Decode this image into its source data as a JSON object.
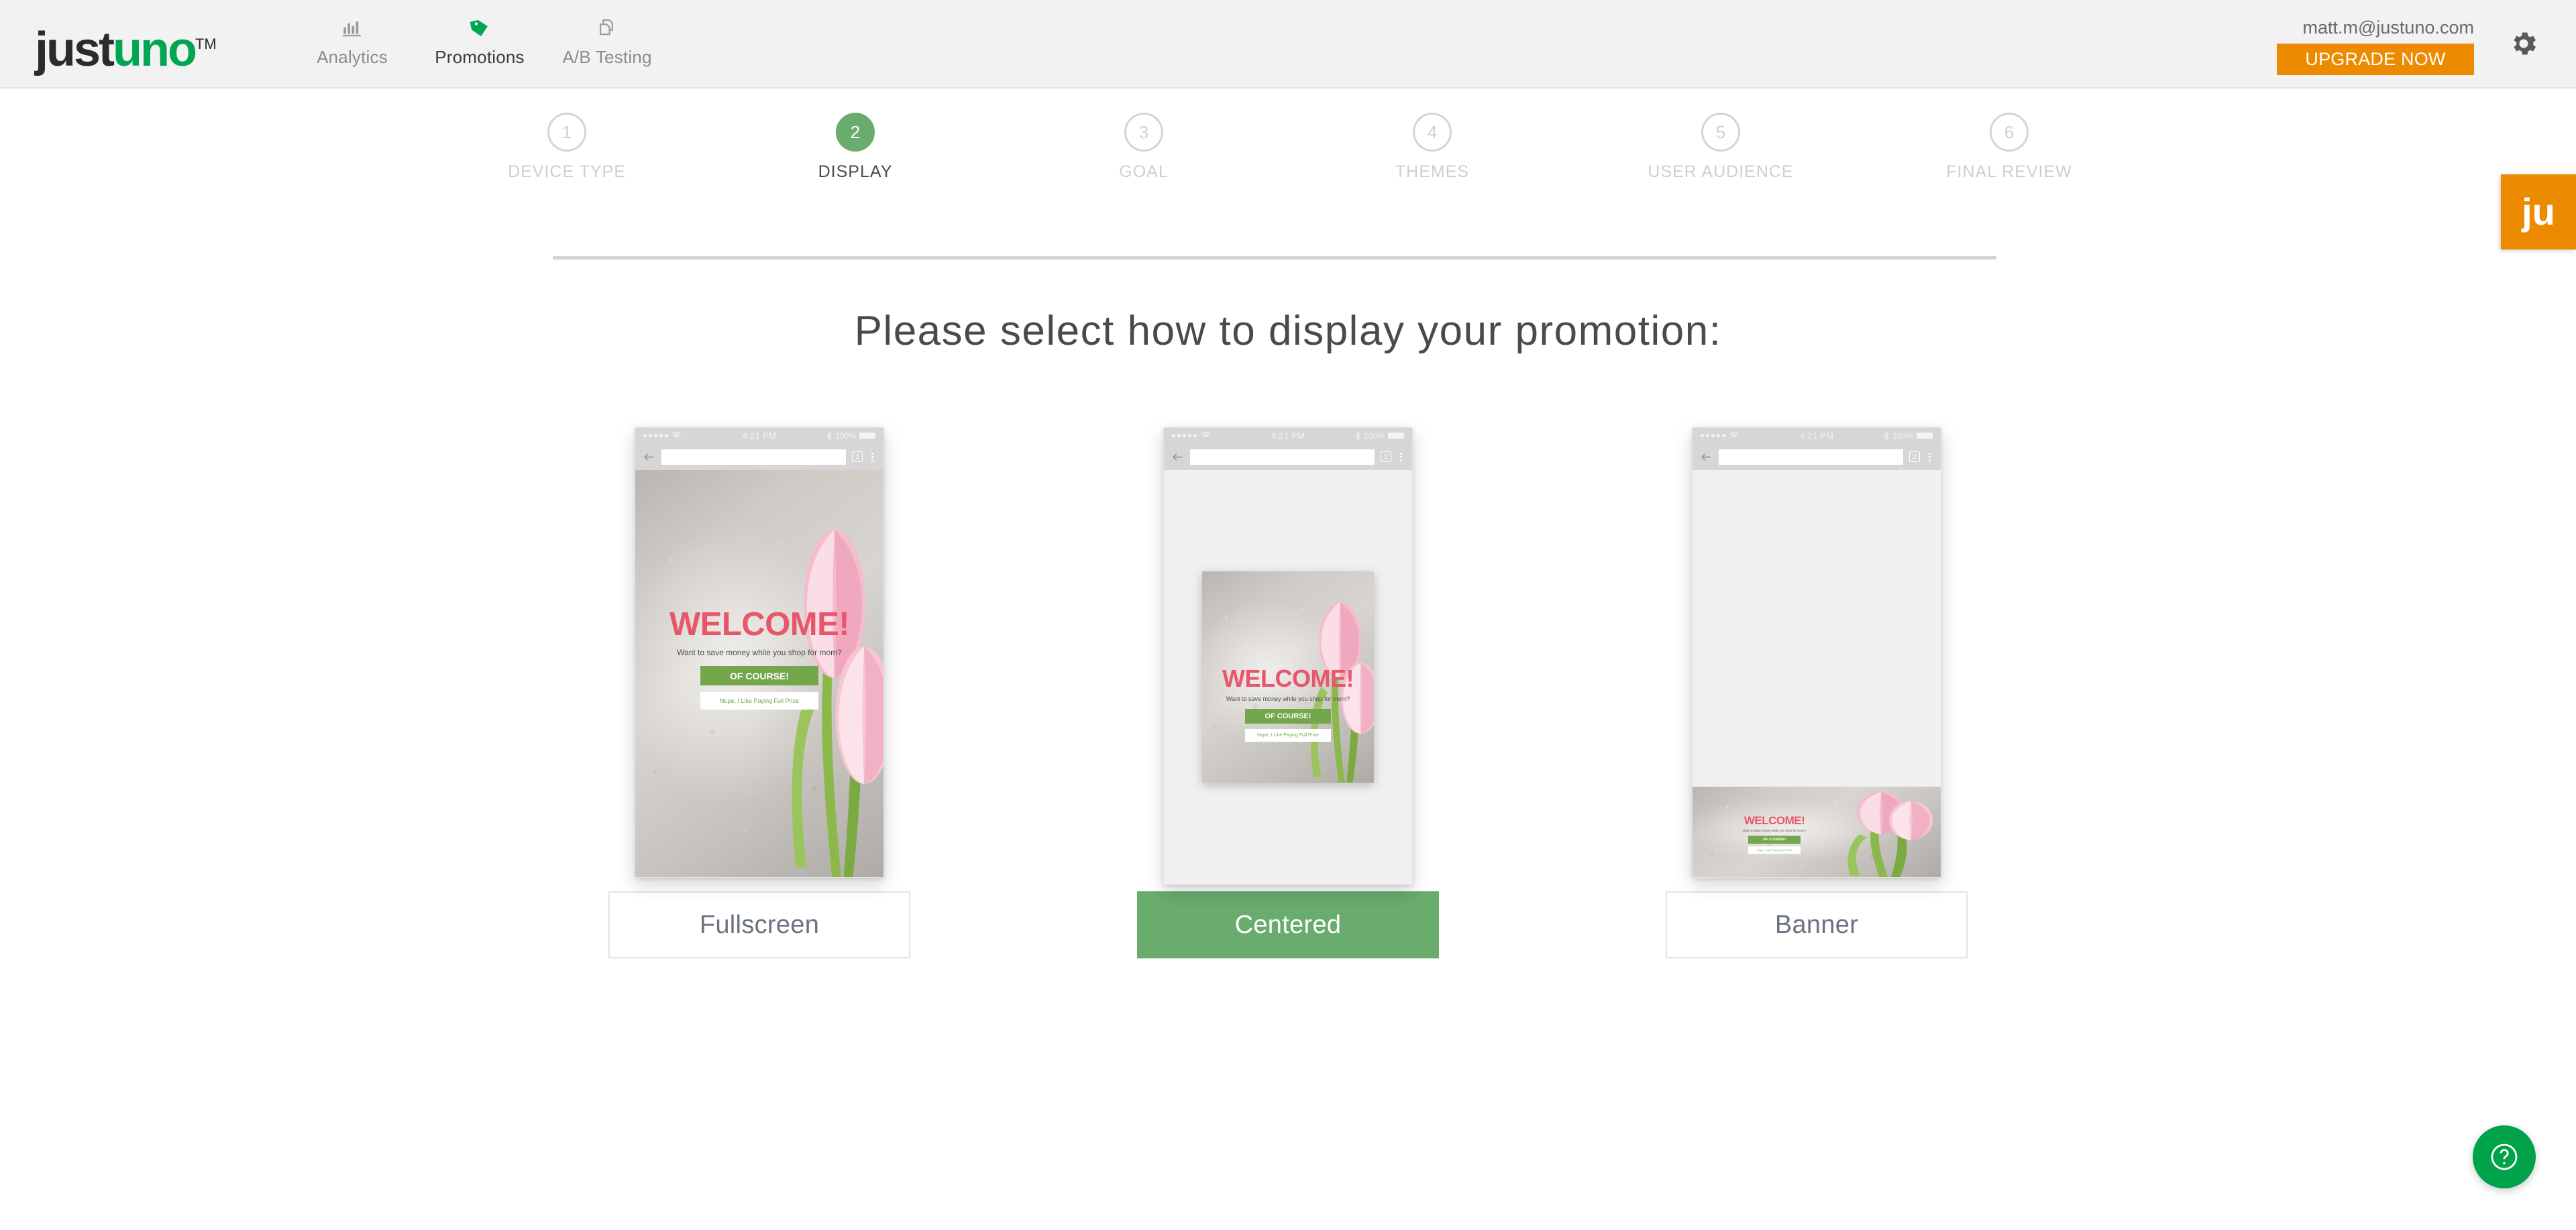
{
  "header": {
    "logo": {
      "part1": "just",
      "part2": "uno",
      "tm": "TM"
    },
    "nav": [
      {
        "label": "Analytics",
        "icon": "bar-chart-icon",
        "active": false
      },
      {
        "label": "Promotions",
        "icon": "tag-icon",
        "active": true
      },
      {
        "label": "A/B Testing",
        "icon": "copy-pages-icon",
        "active": false
      }
    ],
    "email": "matt.m@justuno.com",
    "upgrade_label": "UPGRADE NOW",
    "settings_icon": "gear-icon",
    "brand_orange": "#ed8b00",
    "brand_green": "#00a651"
  },
  "side_tab": {
    "label": "ju"
  },
  "stepper": {
    "active_index": 1,
    "active_color": "#6aab6e",
    "steps": [
      {
        "number": "1",
        "label": "DEVICE TYPE"
      },
      {
        "number": "2",
        "label": "DISPLAY"
      },
      {
        "number": "3",
        "label": "GOAL"
      },
      {
        "number": "4",
        "label": "THEMES"
      },
      {
        "number": "5",
        "label": "USER AUDIENCE"
      },
      {
        "number": "6",
        "label": "FINAL REVIEW"
      }
    ]
  },
  "main": {
    "headline": "Please select how to display your promotion:",
    "phone_chrome": {
      "time": "4:21 PM",
      "battery": "100%",
      "tab_count": "2"
    },
    "promo": {
      "title": "WELCOME!",
      "subtitle": "Want to save money while you shop for mom?",
      "cta_label": "OF COURSE!",
      "decline_label": "Nope, I Like Paying Full Price",
      "title_color": "#e8566a",
      "cta_color": "#74a64b"
    },
    "options": [
      {
        "id": "fullscreen",
        "label": "Fullscreen",
        "selected": false
      },
      {
        "id": "centered",
        "label": "Centered",
        "selected": true
      },
      {
        "id": "banner",
        "label": "Banner",
        "selected": false
      }
    ]
  },
  "help": {
    "icon": "question-mark-icon",
    "color": "#00a34a"
  }
}
